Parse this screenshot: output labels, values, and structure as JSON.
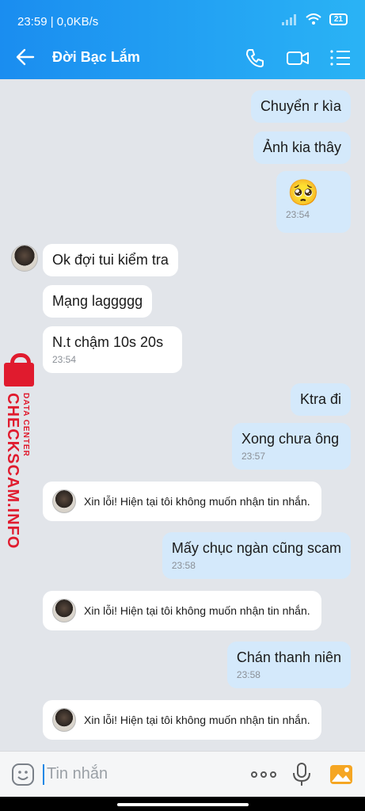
{
  "status": {
    "time": "23:59 | 0,0KB/s",
    "battery": "21"
  },
  "header": {
    "title": "Đời Bạc Lắm"
  },
  "messages": [
    {
      "dir": "out",
      "text": "Chuyển r kìa"
    },
    {
      "dir": "out",
      "text": "Ảnh kia thây"
    },
    {
      "dir": "out",
      "text": "🥺",
      "time": "23:54"
    },
    {
      "dir": "in",
      "text": "Ok đợi tui kiểm tra"
    },
    {
      "dir": "in",
      "text": "Mạng laggggg"
    },
    {
      "dir": "in",
      "text": "N.t chậm 10s 20s",
      "time": "23:54"
    },
    {
      "dir": "out",
      "text": "Ktra đi"
    },
    {
      "dir": "out",
      "text": "Xong chưa ông",
      "time": "23:57"
    },
    {
      "dir": "sys",
      "text": "Xin lỗi! Hiện tại tôi không muốn nhận tin nhắn."
    },
    {
      "dir": "out",
      "text": "Mấy chục ngàn cũng scam",
      "time": "23:58"
    },
    {
      "dir": "sys",
      "text": "Xin lỗi! Hiện tại tôi không muốn nhận tin nhắn."
    },
    {
      "dir": "out",
      "text": "Chán thanh niên",
      "time": "23:58"
    },
    {
      "dir": "sys",
      "text": "Xin lỗi! Hiện tại tôi không muốn nhận tin nhắn."
    }
  ],
  "watermark": {
    "big": "CHECKSCAM.INFO",
    "small": "DATA CENTER"
  },
  "input": {
    "placeholder": "Tin nhắn"
  },
  "colors": {
    "accent": "#1a8df0",
    "outgoing": "#d4e9fb",
    "incoming": "#ffffff",
    "watermark": "#e01b2e"
  }
}
